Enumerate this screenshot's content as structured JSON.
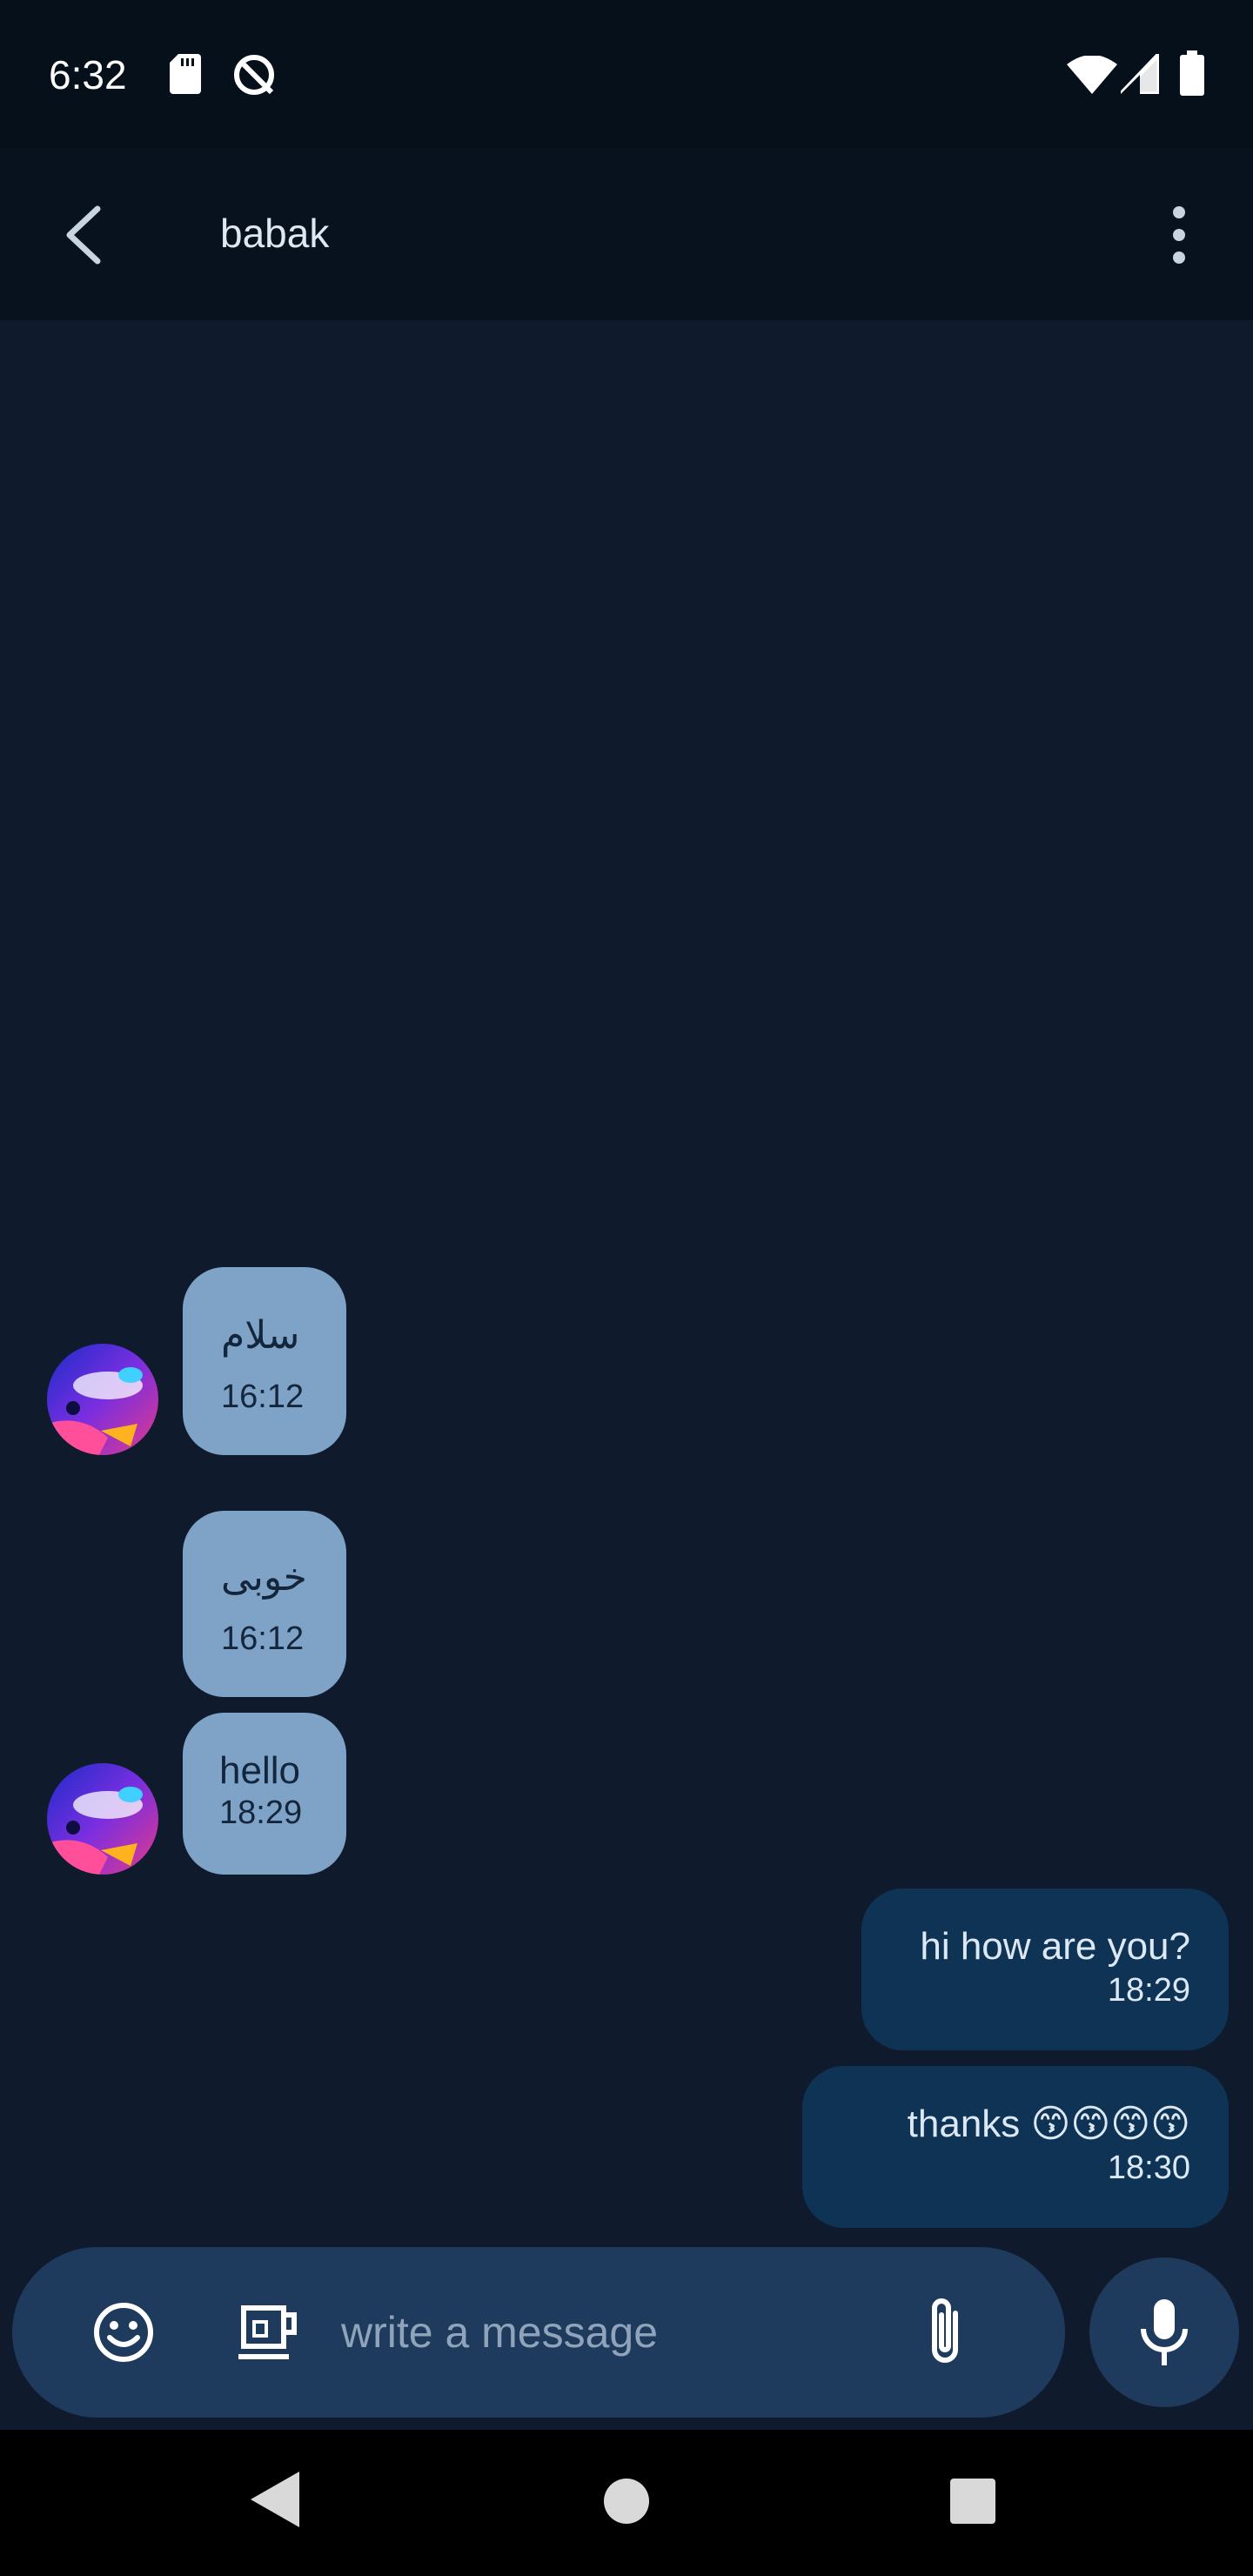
{
  "status_bar": {
    "time": "6:32"
  },
  "header": {
    "title": "babak"
  },
  "messages": [
    {
      "direction": "incoming",
      "text": "سلام",
      "time": "16:12",
      "show_avatar": true
    },
    {
      "direction": "incoming",
      "text": "خوبی",
      "time": "16:12",
      "show_avatar": false
    },
    {
      "direction": "incoming",
      "text": "hello",
      "time": "18:29",
      "show_avatar": true
    },
    {
      "direction": "outgoing",
      "text": "hi how are you?",
      "time": "18:29"
    },
    {
      "direction": "outgoing",
      "text": "thanks 😙😙😙😙",
      "time": "18:30"
    }
  ],
  "composer": {
    "placeholder": "write a message",
    "value": ""
  },
  "colors": {
    "background": "#0f1b2d",
    "incoming_bubble": "#7fa2c7",
    "outgoing_bubble": "#0f3354",
    "input_bar": "#1e3a5c"
  },
  "icons": {
    "back": "arrow-back-icon",
    "more": "more-vert-icon",
    "emoji": "emoji-icon",
    "sticker": "sticker-icon",
    "attach": "paperclip-icon",
    "mic": "mic-icon"
  }
}
